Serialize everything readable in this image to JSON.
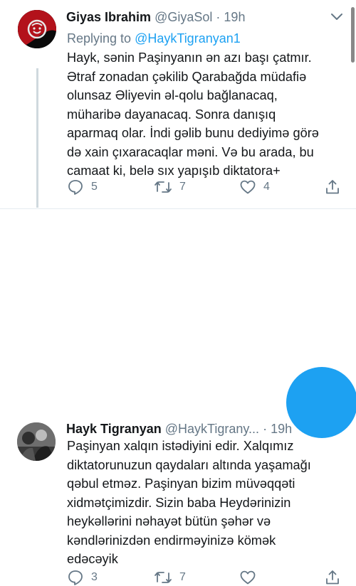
{
  "tweets": [
    {
      "author_name": "Giyas Ibrahim",
      "handle": "@GiyaSol",
      "separator": "·",
      "time": "19h",
      "replying_prefix": "Replying to",
      "replying_to": "@HaykTigranyan1",
      "text": "Hayk, sənin Paşinyanın ən azı başı çatmır.\nƏtraf zonadan çəkilib Qarabağda müdafiə\nolunsaz Əliyevin əl-qolu bağlanacaq,\nmüharibə dayanacaq. Sonra danışıq\naparmaq olar. İndi gəlib bunu dediyimə görə\ndə xain çıxaracaqlar məni. Və bu arada, bu\ncamaat ki, belə sıx yapışıb diktatora+",
      "replies": "5",
      "retweets": "7",
      "likes": "4"
    },
    {
      "author_name": "Hayk Tigranyan",
      "handle": "@HaykTigrany...",
      "separator": "·",
      "time": "19h",
      "text": "Paşinyan xalqın istədiyini edir. Xalqımız\ndiktatorunuzun qaydaları altında yaşamağı\nqəbul etməz. Paşinyan bizim müvəqqəti\nxidmətçimizdir. Sizin baba Heydərinizin\nheykəllərini nəhayət bütün şəhər və\nkəndlərinizdən endirməyinizə kömək\nedəcəyik",
      "replies": "3",
      "retweets": "7",
      "likes": ""
    }
  ],
  "icons": {
    "reply": "speech-bubble-icon",
    "retweet": "retweet-icon",
    "like": "heart-icon",
    "share": "share-icon",
    "more": "chevron-down-icon"
  },
  "colors": {
    "link": "#1da1f2",
    "muted": "#657786",
    "text": "#14171a",
    "thread_line": "#cfd9de"
  }
}
